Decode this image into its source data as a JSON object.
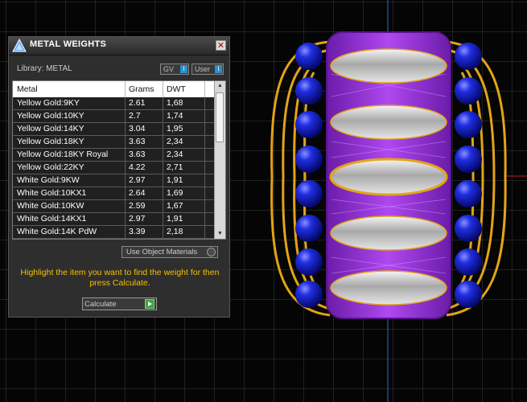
{
  "panel": {
    "title": "METAL WEIGHTS",
    "library_label": "Library: METAL",
    "gv_button": "GV",
    "user_button": "User",
    "columns": [
      "Metal",
      "Grams",
      "DWT"
    ],
    "rows": [
      {
        "metal": "Yellow Gold:9KY",
        "grams": "2.61",
        "dwt": "1,68"
      },
      {
        "metal": "Yellow Gold:10KY",
        "grams": "2.7",
        "dwt": "1,74"
      },
      {
        "metal": "Yellow Gold:14KY",
        "grams": "3.04",
        "dwt": "1,95"
      },
      {
        "metal": "Yellow Gold:18KY",
        "grams": "3.63",
        "dwt": "2,34"
      },
      {
        "metal": "Yellow Gold:18KY Royal",
        "grams": "3.63",
        "dwt": "2,34"
      },
      {
        "metal": "Yellow Gold:22KY",
        "grams": "4.22",
        "dwt": "2,71"
      },
      {
        "metal": "White Gold:9KW",
        "grams": "2.97",
        "dwt": "1,91"
      },
      {
        "metal": "White Gold:10KX1",
        "grams": "2.64",
        "dwt": "1,69"
      },
      {
        "metal": "White Gold:10KW",
        "grams": "2.59",
        "dwt": "1,67"
      },
      {
        "metal": "White Gold:14KX1",
        "grams": "2.97",
        "dwt": "1,91"
      },
      {
        "metal": "White Gold:14K PdW",
        "grams": "3.39",
        "dwt": "2,18"
      }
    ],
    "use_object_materials": "Use Object Materials",
    "hint": "Highlight the item you want to find the weight for then press Calculate.",
    "calculate_button": "Calculate"
  },
  "colors": {
    "background": "#050505",
    "grid": "#3c3c3c",
    "gold": "#e2a416",
    "purple": "#9b32d8",
    "blue_gem": "#1a22c8",
    "silver": "#c8c8c8",
    "hint_text": "#f5c000"
  }
}
